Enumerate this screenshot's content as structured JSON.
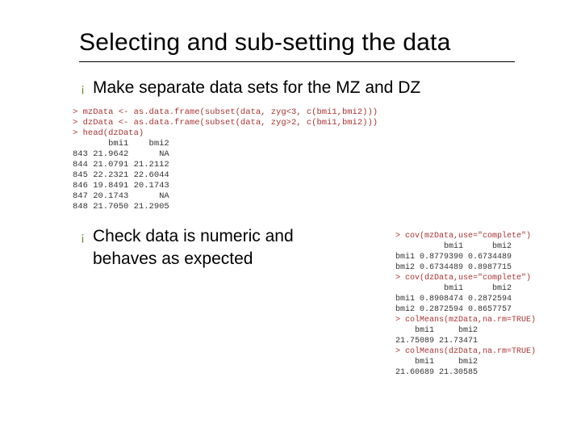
{
  "title": "Selecting and sub-setting the data",
  "bullets": {
    "b1": "Make separate data sets for the MZ and DZ",
    "b2": "Check data is numeric and behaves as expected"
  },
  "code1": {
    "l1": "> mzData <- as.data.frame(subset(data, zyg<3, c(bmi1,bmi2)))",
    "l2": "> dzData <- as.data.frame(subset(data, zyg>2, c(bmi1,bmi2)))",
    "l3": "> head(dzData)",
    "l4": "       bmi1    bmi2",
    "l5": "843 21.9642      NA",
    "l6": "844 21.0791 21.2112",
    "l7": "845 22.2321 22.6044",
    "l8": "846 19.8491 20.1743",
    "l9": "847 20.1743      NA",
    "l10": "848 21.7050 21.2905"
  },
  "code2": {
    "l1": "> cov(mzData,use=\"complete\")",
    "l2": "          bmi1      bmi2",
    "l3": "bmi1 0.8779390 0.6734489",
    "l4": "bmi2 0.6734489 0.8987715",
    "l5": "> cov(dzData,use=\"complete\")",
    "l6": "          bmi1      bmi2",
    "l7": "bmi1 0.8908474 0.2872594",
    "l8": "bmi2 0.2872594 0.8657757",
    "l9": "> colMeans(mzData,na.rm=TRUE)",
    "l10": "    bmi1     bmi2",
    "l11": "21.75089 21.73471",
    "l12": "> colMeans(dzData,na.rm=TRUE)",
    "l13": "    bmi1     bmi2",
    "l14": "21.60689 21.30585"
  }
}
